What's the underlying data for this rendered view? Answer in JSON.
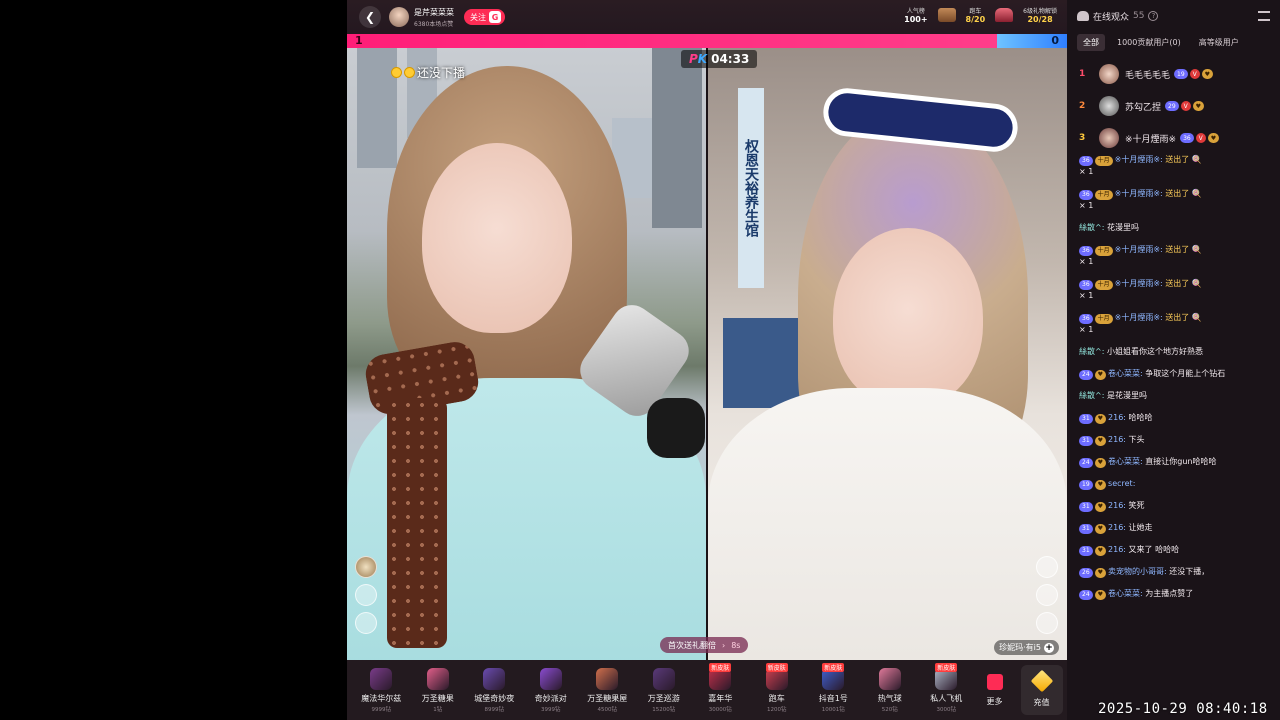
{
  "host": {
    "name": "是芹菜菜菜",
    "likes": "6380本场点赞",
    "follow_label": "关注",
    "follow_badge": "G"
  },
  "top_stats": [
    {
      "label": "人气榜",
      "value": "100+"
    },
    {
      "label": "跑车",
      "value": "8/20"
    },
    {
      "label": "6级礼物解锁",
      "value": "20/28"
    }
  ],
  "pk": {
    "left_score": "1",
    "right_score": "0",
    "timer": "04:33"
  },
  "left_caption": "还没下播",
  "first_gift_tip": {
    "text": "首次送礼翻倍",
    "seconds": "8s"
  },
  "opponent_tip": "珍妮玛·有i5",
  "gifts": [
    {
      "name": "魔法华尔兹",
      "price": "9999钻",
      "color": "#7a3c8a",
      "tag": ""
    },
    {
      "name": "万圣糖果",
      "price": "1钻",
      "color": "#e25f8a",
      "tag": ""
    },
    {
      "name": "城堡奇妙夜",
      "price": "8999钻",
      "color": "#6a4cb0",
      "tag": ""
    },
    {
      "name": "奇妙派对",
      "price": "3999钻",
      "color": "#8a4cd0",
      "tag": ""
    },
    {
      "name": "万圣糖果屋",
      "price": "4500钻",
      "color": "#d0704c",
      "tag": ""
    },
    {
      "name": "万圣巡游",
      "price": "15200钻",
      "color": "#5a3a7a",
      "tag": ""
    },
    {
      "name": "嘉年华",
      "price": "30000钻",
      "color": "#c0304a",
      "tag": "新皮肤"
    },
    {
      "name": "跑车",
      "price": "1200钻",
      "color": "#d04050",
      "tag": "新皮肤"
    },
    {
      "name": "抖音1号",
      "price": "10001钻",
      "color": "#4060d0",
      "tag": "新皮肤"
    },
    {
      "name": "热气球",
      "price": "520钻",
      "color": "#e07a9a",
      "tag": ""
    },
    {
      "name": "私人飞机",
      "price": "3000钻",
      "color": "#b0b8c8",
      "tag": "新皮肤"
    }
  ],
  "more_label": "更多",
  "recharge_label": "充值",
  "panel": {
    "title": "在线观众",
    "count": "55",
    "tabs": [
      "全部",
      "1000贡献用户(0)",
      "高等级用户"
    ],
    "ranking": [
      {
        "rank": "1",
        "name": "毛毛毛毛毛",
        "level": "19"
      },
      {
        "rank": "2",
        "name": "苏勾乙捏",
        "level": "29"
      },
      {
        "rank": "3",
        "name": "※十月煙雨※",
        "level": "36"
      }
    ],
    "chat": [
      {
        "level": "36",
        "fan": "十月",
        "user": "※十月煙雨※:",
        "text": "送出了",
        "extra": "× 1",
        "gift": true
      },
      {
        "level": "36",
        "fan": "十月",
        "user": "※十月煙雨※:",
        "text": "送出了",
        "extra": "× 1",
        "gift": true
      },
      {
        "level": "",
        "fan": "",
        "user": "絲散^:",
        "text": "花漫里吗",
        "extra": "",
        "gift": false
      },
      {
        "level": "36",
        "fan": "十月",
        "user": "※十月煙雨※:",
        "text": "送出了",
        "extra": "× 1",
        "gift": true
      },
      {
        "level": "36",
        "fan": "十月",
        "user": "※十月煙雨※:",
        "text": "送出了",
        "extra": "× 1",
        "gift": true
      },
      {
        "level": "36",
        "fan": "十月",
        "user": "※十月煙雨※:",
        "text": "送出了",
        "extra": "× 1",
        "gift": true
      },
      {
        "level": "",
        "fan": "",
        "user": "絲散^:",
        "text": "小姐姐看你这个地方好熟悉",
        "extra": "",
        "gift": false
      },
      {
        "level": "24",
        "fan": "",
        "user": "卷心菜菜:",
        "text": "争取这个月能上个钻石",
        "extra": "",
        "gift": false
      },
      {
        "level": "",
        "fan": "",
        "user": "絲散^:",
        "text": "是花漫里吗",
        "extra": "",
        "gift": false
      },
      {
        "level": "31",
        "fan": "",
        "user": "216:",
        "text": "哈哈哈",
        "extra": "",
        "gift": false
      },
      {
        "level": "31",
        "fan": "",
        "user": "216:",
        "text": "下头",
        "extra": "",
        "gift": false
      },
      {
        "level": "24",
        "fan": "",
        "user": "卷心菜菜:",
        "text": "直接让你gun哈哈哈",
        "extra": "",
        "gift": false
      },
      {
        "level": "19",
        "fan": "",
        "user": "secret:",
        "text": "",
        "extra": "",
        "gift": false
      },
      {
        "level": "31",
        "fan": "",
        "user": "216:",
        "text": "笑死",
        "extra": "",
        "gift": false
      },
      {
        "level": "31",
        "fan": "",
        "user": "216:",
        "text": "让她走",
        "extra": "",
        "gift": false
      },
      {
        "level": "31",
        "fan": "",
        "user": "216:",
        "text": "又来了 哈哈哈",
        "extra": "",
        "gift": false
      },
      {
        "level": "26",
        "fan": "",
        "user": "卖宠物的小哥哥:",
        "text": "还没下播，",
        "extra": "",
        "gift": false
      },
      {
        "level": "24",
        "fan": "",
        "user": "卷心菜菜:",
        "text": "为主播点赞了",
        "extra": "",
        "gift": false
      }
    ]
  },
  "clock": "2025-10-29 08:40:18"
}
